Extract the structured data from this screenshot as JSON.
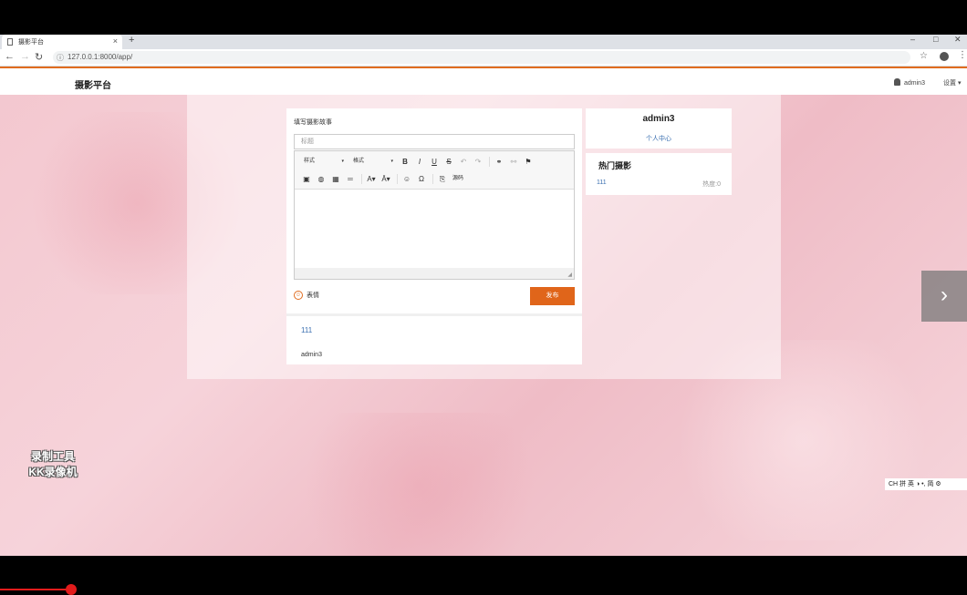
{
  "browser": {
    "tab_title": "摄影平台",
    "tab_close": "×",
    "new_tab": "+",
    "url": "127.0.0.1:8000/app/",
    "win_min": "–",
    "win_max": "□",
    "win_close": "✕"
  },
  "header": {
    "brand": "摄影平台",
    "username": "admin3",
    "settings": "设置 ▾"
  },
  "editor": {
    "label": "填写摄影故事",
    "title_placeholder": "标题",
    "style_combo": "样式",
    "format_combo": "格式",
    "source_label": "源码",
    "emoji_label": "表情",
    "publish": "发布"
  },
  "post": {
    "title": "111",
    "author": "admin3"
  },
  "sidebar": {
    "user_name": "admin3",
    "profile_link": "个人中心",
    "hot_title": "热门摄影",
    "hot_item_title": "111",
    "hot_item_heat": "热度:0"
  },
  "overlay": {
    "watermark_line1": "录制工具",
    "watermark_line2": "KK录像机",
    "ime": "CH 拼 英 ◑ •, 简 ⚙"
  }
}
